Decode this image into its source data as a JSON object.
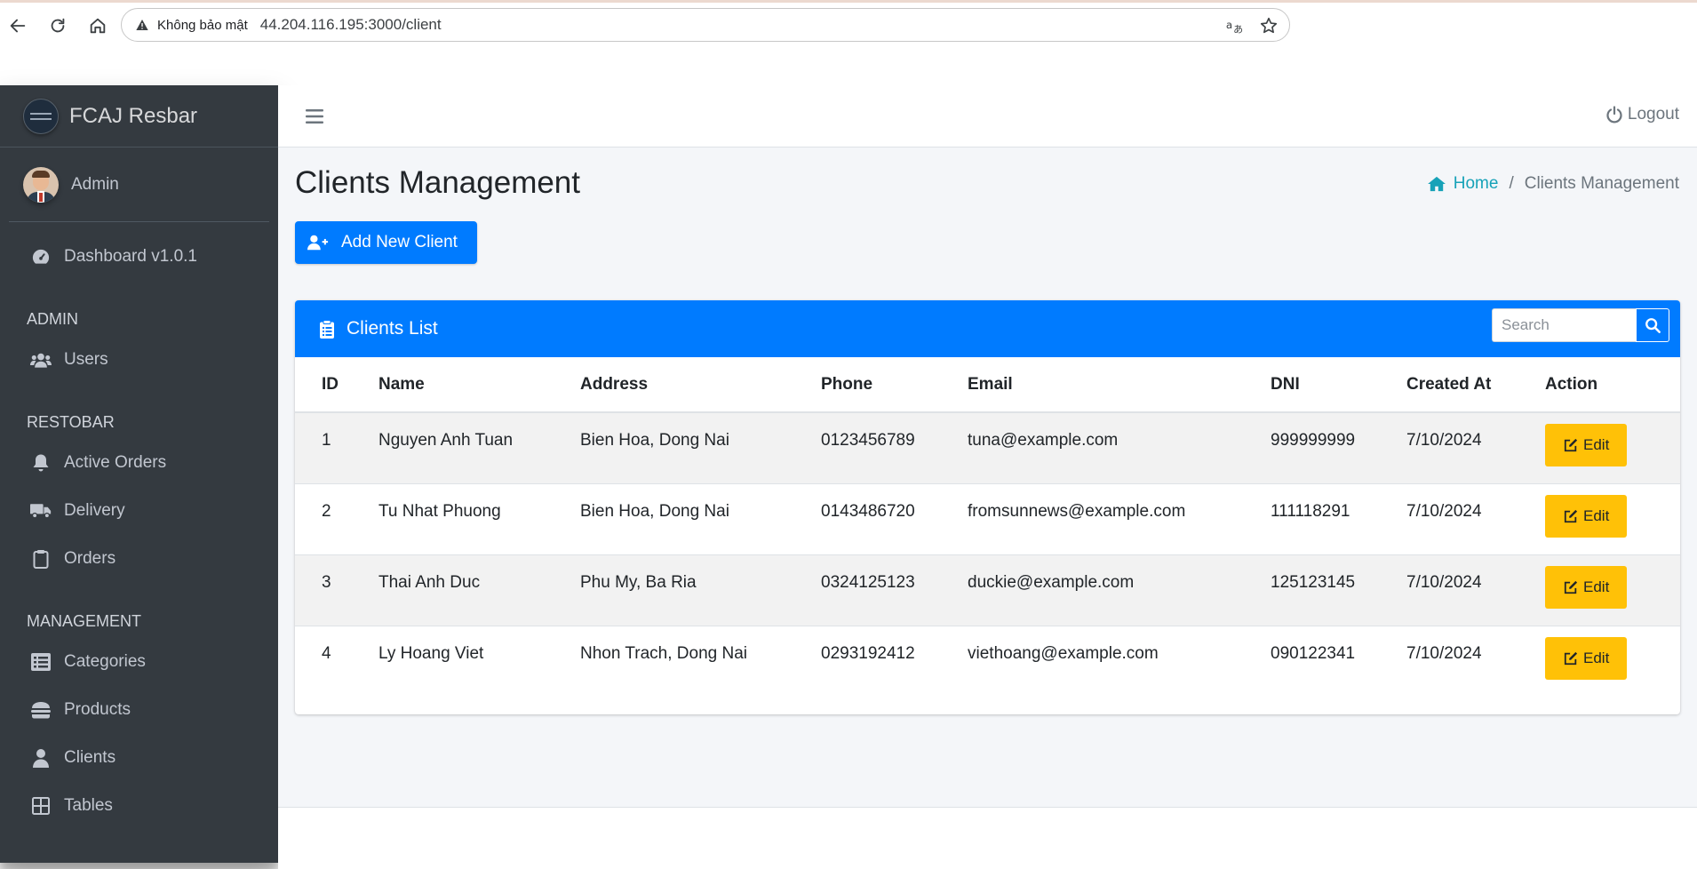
{
  "browser": {
    "security_label": "Không bảo mật",
    "url": "44.204.116.195:3000/client"
  },
  "sidebar": {
    "brand": "FCAJ Resbar",
    "user": "Admin",
    "dashboard": "Dashboard v1.0.1",
    "sections": {
      "admin": "ADMIN",
      "restobar": "RESTOBAR",
      "management": "MANAGEMENT"
    },
    "items": {
      "users": "Users",
      "active_orders": "Active Orders",
      "delivery": "Delivery",
      "orders": "Orders",
      "categories": "Categories",
      "products": "Products",
      "clients": "Clients",
      "tables": "Tables"
    }
  },
  "topbar": {
    "logout": "Logout"
  },
  "page": {
    "title": "Clients Management",
    "breadcrumb_home": "Home",
    "breadcrumb_sep": "/",
    "breadcrumb_current": "Clients Management",
    "add_button": "Add New Client"
  },
  "card": {
    "title": "Clients List",
    "search_placeholder": "Search"
  },
  "table": {
    "headers": [
      "ID",
      "Name",
      "Address",
      "Phone",
      "Email",
      "DNI",
      "Created At",
      "Action"
    ],
    "edit_label": "Edit",
    "rows": [
      {
        "id": "1",
        "name": "Nguyen Anh Tuan",
        "address": "Bien Hoa, Dong Nai",
        "phone": "0123456789",
        "email": "tuna@example.com",
        "dni": "999999999",
        "created": "7/10/2024"
      },
      {
        "id": "2",
        "name": "Tu Nhat Phuong",
        "address": "Bien Hoa, Dong Nai",
        "phone": "0143486720",
        "email": "fromsunnews@example.com",
        "dni": "111118291",
        "created": "7/10/2024"
      },
      {
        "id": "3",
        "name": "Thai Anh Duc",
        "address": "Phu My, Ba Ria",
        "phone": "0324125123",
        "email": "duckie@example.com",
        "dni": "125123145",
        "created": "7/10/2024"
      },
      {
        "id": "4",
        "name": "Ly Hoang Viet",
        "address": "Nhon Trach, Dong Nai",
        "phone": "0293192412",
        "email": "viethoang@example.com",
        "dni": "090122341",
        "created": "7/10/2024"
      }
    ]
  },
  "colors": {
    "primary": "#007bff",
    "sidebar_bg": "#343a40",
    "warning": "#ffc107",
    "info": "#17a2b8"
  }
}
